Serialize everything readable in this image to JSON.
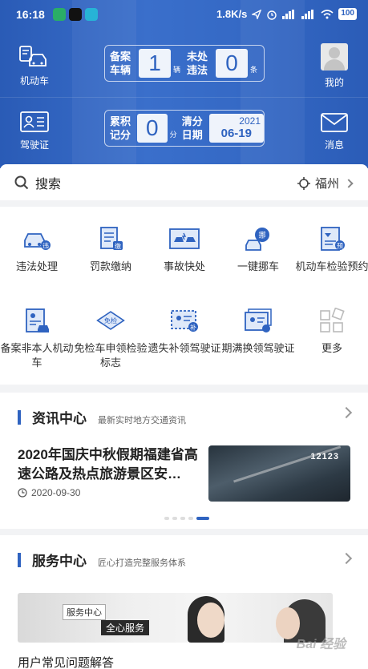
{
  "status_bar": {
    "time": "16:18",
    "network_speed": "1.8K/s",
    "battery": "100"
  },
  "header": {
    "vehicle_label": "机动车",
    "license_label": "驾驶证",
    "mine_label": "我的",
    "messages_label": "消息",
    "panel1": {
      "registered_label_1": "备案",
      "registered_label_2": "车辆",
      "registered_count": "1",
      "registered_unit": "辆",
      "violations_label_1": "未处",
      "violations_label_2": "违法",
      "violations_count": "0",
      "violations_unit": "条"
    },
    "panel2": {
      "points_label_1": "累积",
      "points_label_2": "记分",
      "points_value": "0",
      "points_unit": "分",
      "clear_label_1": "清分",
      "clear_label_2": "日期",
      "clear_year": "2021",
      "clear_date": "06-19"
    }
  },
  "search": {
    "label": "搜索",
    "city": "福州"
  },
  "services": [
    {
      "label": "违法处理"
    },
    {
      "label": "罚款缴纳"
    },
    {
      "label": "事故快处"
    },
    {
      "label": "一键挪车"
    },
    {
      "label": "机动车检验预约"
    },
    {
      "label": "备案非本人机动车"
    },
    {
      "label": "免检车申领检验标志"
    },
    {
      "label": "遗失补领驾驶证"
    },
    {
      "label": "期满换领驾驶证"
    },
    {
      "label": "更多"
    }
  ],
  "service_icon_text": {
    "violation_badge": "违",
    "fine_badge": "缴",
    "move_badge": "挪",
    "inspect_badge": "预",
    "exempt_badge": "免检",
    "reissue_badge": "补"
  },
  "news": {
    "title": "资讯中心",
    "subtitle": "最新实时地方交通资讯",
    "headline": "2020年国庆中秋假期福建省高速公路及热点旅游景区安…",
    "date": "2020-09-30",
    "image_tag": "12123"
  },
  "service_center": {
    "title": "服务中心",
    "subtitle": "匠心打造完整服务体系",
    "banner_tag1": "服务中心",
    "banner_tag2": "全心服务",
    "caption": "用户常见问题解答",
    "watermark": "Bai 经验"
  },
  "colors": {
    "brand_blue": "#2f63c0",
    "background": "#f2f3f5"
  }
}
